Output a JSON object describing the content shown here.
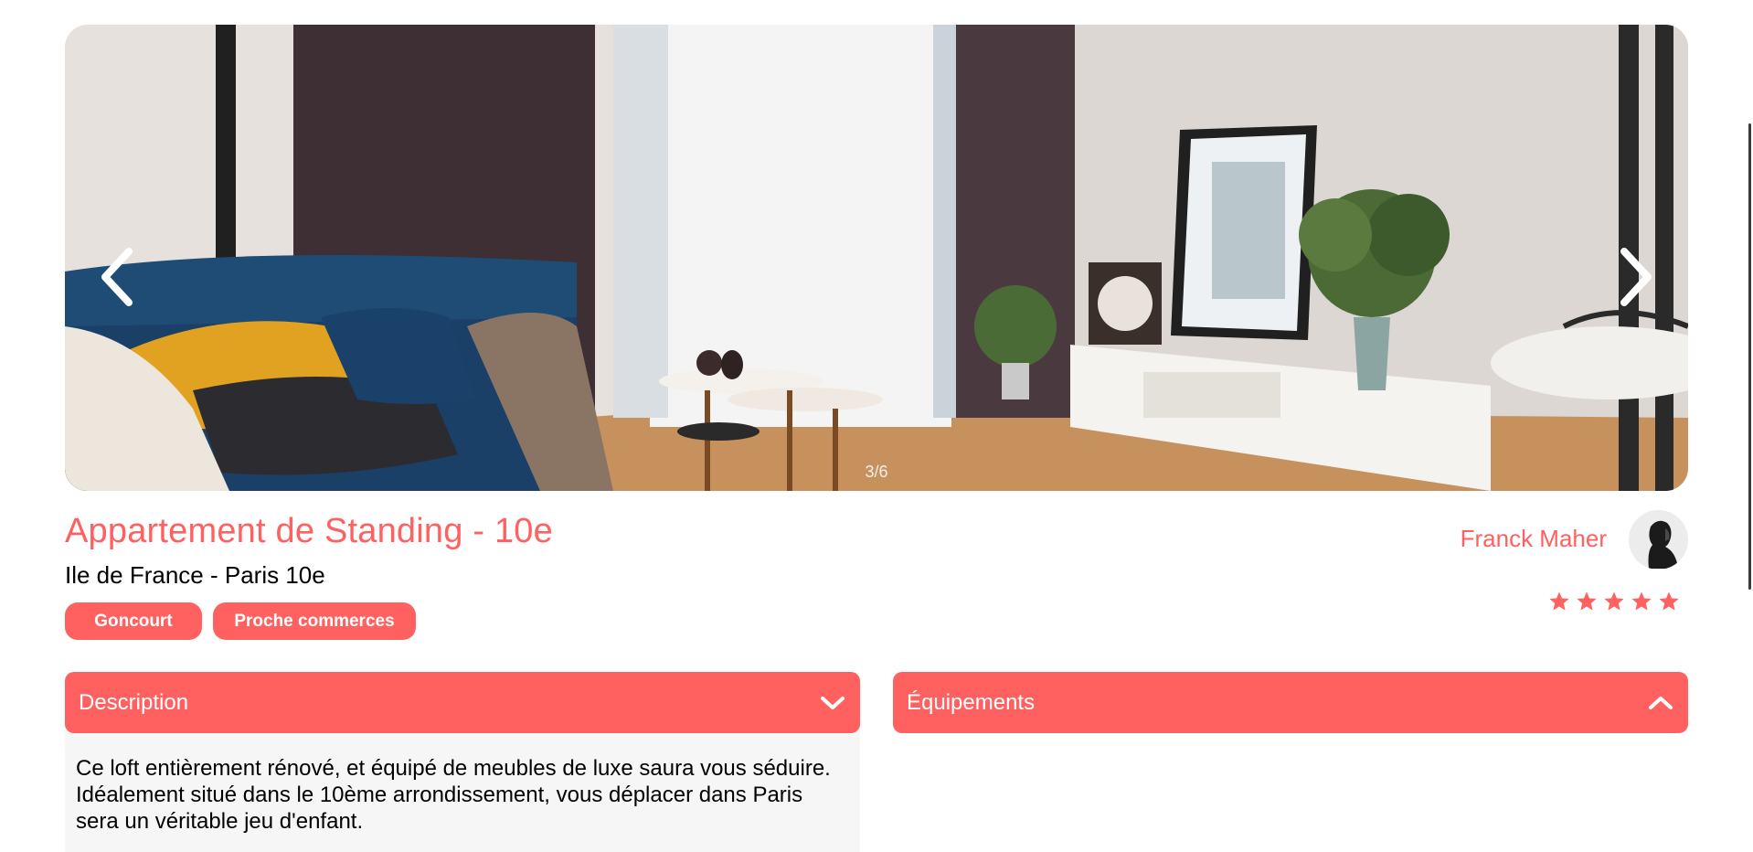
{
  "carousel": {
    "counter": "3/6",
    "prev_icon": "chevron-left-icon",
    "next_icon": "chevron-right-icon"
  },
  "listing": {
    "title": "Appartement de Standing - 10e",
    "location": "Ile de France - Paris 10e",
    "tags": [
      "Goncourt",
      "Proche commerces"
    ]
  },
  "host": {
    "name": "Franck Maher",
    "rating": 5,
    "rating_max": 5
  },
  "collapses": {
    "description": {
      "title": "Description",
      "icon": "chevron-down-icon",
      "content": "Ce loft entièrement rénové, et équipé de meubles de luxe saura vous séduire. Idéalement situé dans le 10ème arrondissement, vous déplacer dans Paris sera un véritable jeu d'enfant."
    },
    "equipment": {
      "title": "Équipements",
      "icon": "chevron-up-icon"
    }
  },
  "colors": {
    "accent": "#ff6060",
    "content_bg": "#f6f6f6"
  }
}
